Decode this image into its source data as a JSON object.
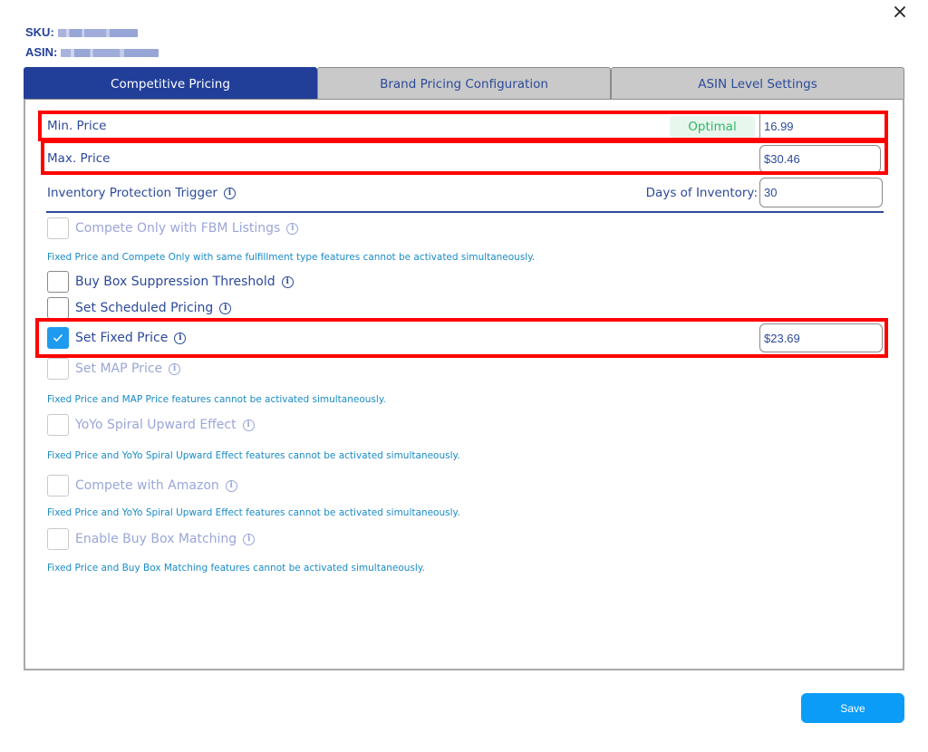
{
  "header": {
    "sku_label": "SKU:",
    "asin_label": "ASIN:",
    "close_icon": "close-icon"
  },
  "tabs": [
    {
      "label": "Competitive Pricing",
      "active": true
    },
    {
      "label": "Brand Pricing Configuration",
      "active": false
    },
    {
      "label": "ASIN Level Settings",
      "active": false
    }
  ],
  "pricing": {
    "min_price_label": "Min. Price",
    "min_price_status": "Optimal",
    "min_price_value": "16.99",
    "max_price_label": "Max. Price",
    "max_price_value": "$30.46",
    "inventory_label": "Inventory Protection Trigger",
    "days_label": "Days of Inventory:",
    "days_value": "30"
  },
  "options": [
    {
      "label": "Compete Only with FBM Listings",
      "checked": false,
      "disabled": true,
      "note": "Fixed Price and Compete Only with same fulfillment type features cannot be activated simultaneously."
    },
    {
      "label": "Buy Box Suppression Threshold",
      "checked": false,
      "disabled": false
    },
    {
      "label": "Set Scheduled Pricing",
      "checked": false,
      "disabled": false
    },
    {
      "label": "Set Fixed Price",
      "checked": true,
      "disabled": false,
      "value": "$23.69"
    },
    {
      "label": "Set MAP Price",
      "checked": false,
      "disabled": true,
      "note": "Fixed Price and MAP Price features cannot be activated simultaneously."
    },
    {
      "label": "YoYo Spiral Upward Effect",
      "checked": false,
      "disabled": true,
      "note": "Fixed Price and YoYo Spiral Upward Effect features cannot be activated simultaneously."
    },
    {
      "label": "Compete with Amazon",
      "checked": false,
      "disabled": true,
      "note": "Fixed Price and YoYo Spiral Upward Effect features cannot be activated simultaneously."
    },
    {
      "label": "Enable Buy Box Matching",
      "checked": false,
      "disabled": true,
      "note": "Fixed Price and Buy Box Matching features cannot be activated simultaneously."
    }
  ],
  "footer": {
    "save_label": "Save"
  },
  "colors": {
    "active_tab": "#213f99",
    "highlight": "#ff0000",
    "save": "#0a9cf7",
    "optimal_text": "#2fb865",
    "checkbox_checked": "#1e9bef"
  }
}
